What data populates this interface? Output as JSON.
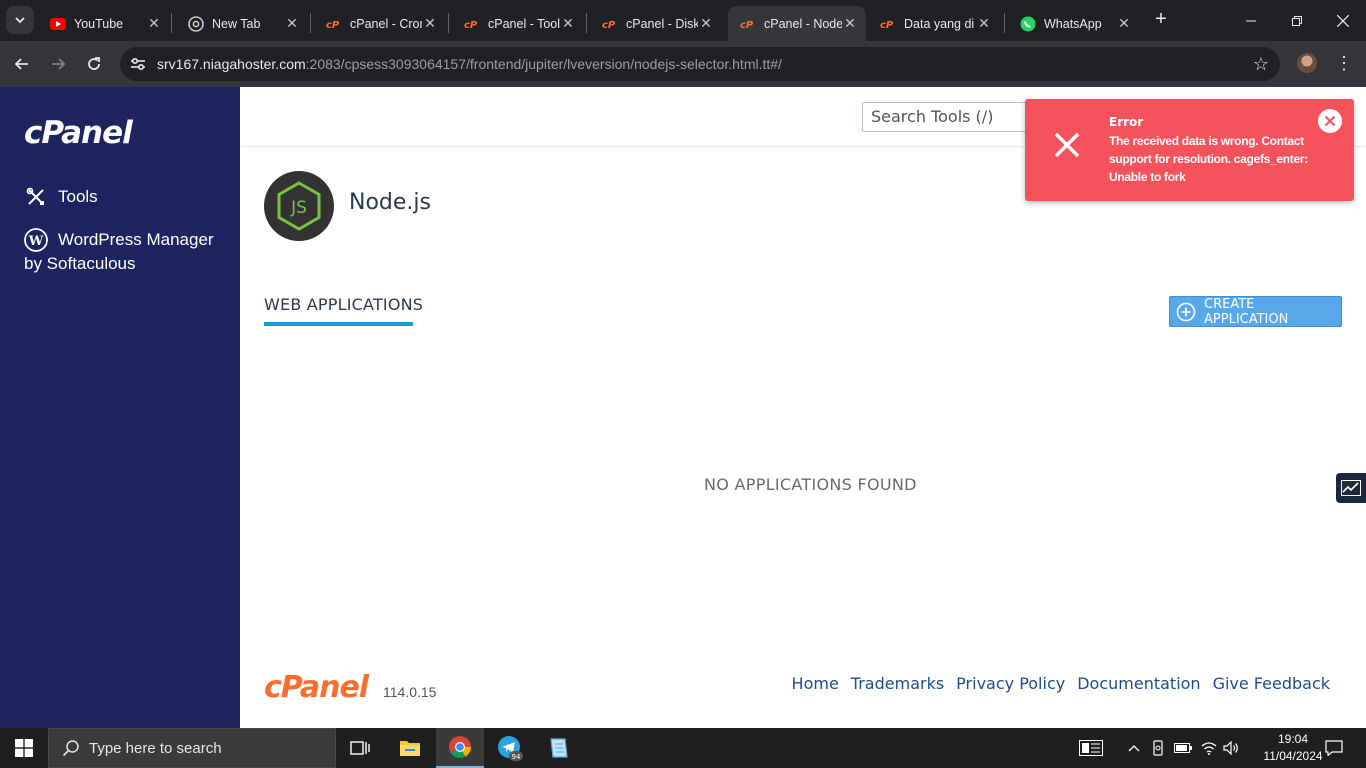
{
  "browser": {
    "tabs": [
      {
        "title": "YouTube",
        "favicon": "youtube-icon"
      },
      {
        "title": "New Tab",
        "favicon": "chrome-icon"
      },
      {
        "title": "cPanel - Cron",
        "favicon": "cpanel-icon"
      },
      {
        "title": "cPanel - Tools",
        "favicon": "cpanel-icon"
      },
      {
        "title": "cPanel - Disk",
        "favicon": "cpanel-icon"
      },
      {
        "title": "cPanel - Node",
        "favicon": "cpanel-icon"
      },
      {
        "title": "Data yang di",
        "favicon": "cpanel-icon"
      },
      {
        "title": "WhatsApp",
        "favicon": "whatsapp-icon"
      }
    ],
    "url_host": "srv167.niagahoster.com",
    "url_rest": ":2083/cpsess3093064157/frontend/jupiter/lveversion/nodejs-selector.html.tt#/"
  },
  "sidebar": {
    "logo": "cPanel",
    "items": [
      {
        "label": "Tools",
        "icon": "tools-icon"
      },
      {
        "label": "WordPress Manager by Softaculous",
        "icon": "wordpress-icon"
      }
    ]
  },
  "header": {
    "search_placeholder": "Search Tools (/)"
  },
  "page": {
    "title": "Node.js",
    "tab_label": "WEB APPLICATIONS",
    "create_button": "CREATE APPLICATION",
    "empty_message": "NO APPLICATIONS FOUND"
  },
  "toast": {
    "title": "Error",
    "message": "The received data is wrong. Contact support for resolution. cagefs_enter: Unable to fork",
    "color": "#f5525c"
  },
  "footer": {
    "logo": "cPanel",
    "version": "114.0.15",
    "links": [
      "Home",
      "Trademarks",
      "Privacy Policy",
      "Documentation",
      "Give Feedback"
    ]
  },
  "taskbar": {
    "search_placeholder": "Type here to search",
    "time": "19:04",
    "date": "11/04/2024",
    "telegram_badge": "94"
  },
  "colors": {
    "sidebar_bg": "#1d2460",
    "accent": "#179bd7",
    "button": "#58a7e8",
    "cpanel_orange": "#ff6c2c"
  }
}
